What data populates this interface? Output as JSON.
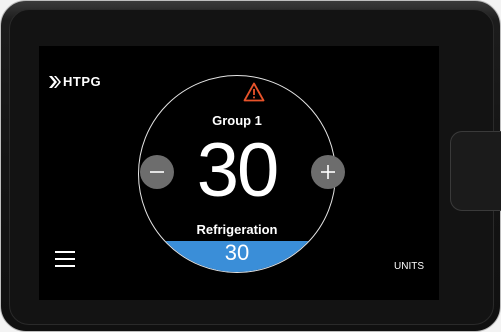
{
  "brand": {
    "logo_text": "HTPG"
  },
  "dial": {
    "group_label": "Group 1",
    "setpoint": "30",
    "mode_label": "Refrigeration",
    "actual_value": "30",
    "alert_icon": "warning-triangle-icon",
    "decrease_icon": "minus-icon",
    "increase_icon": "plus-icon"
  },
  "footer": {
    "menu_icon": "hamburger-menu-icon",
    "units_label": "UNITS"
  },
  "colors": {
    "background": "#000000",
    "accent_blue": "#3a8ed8",
    "alert_orange": "#e8532a",
    "button_gray": "#6d6d6d"
  }
}
